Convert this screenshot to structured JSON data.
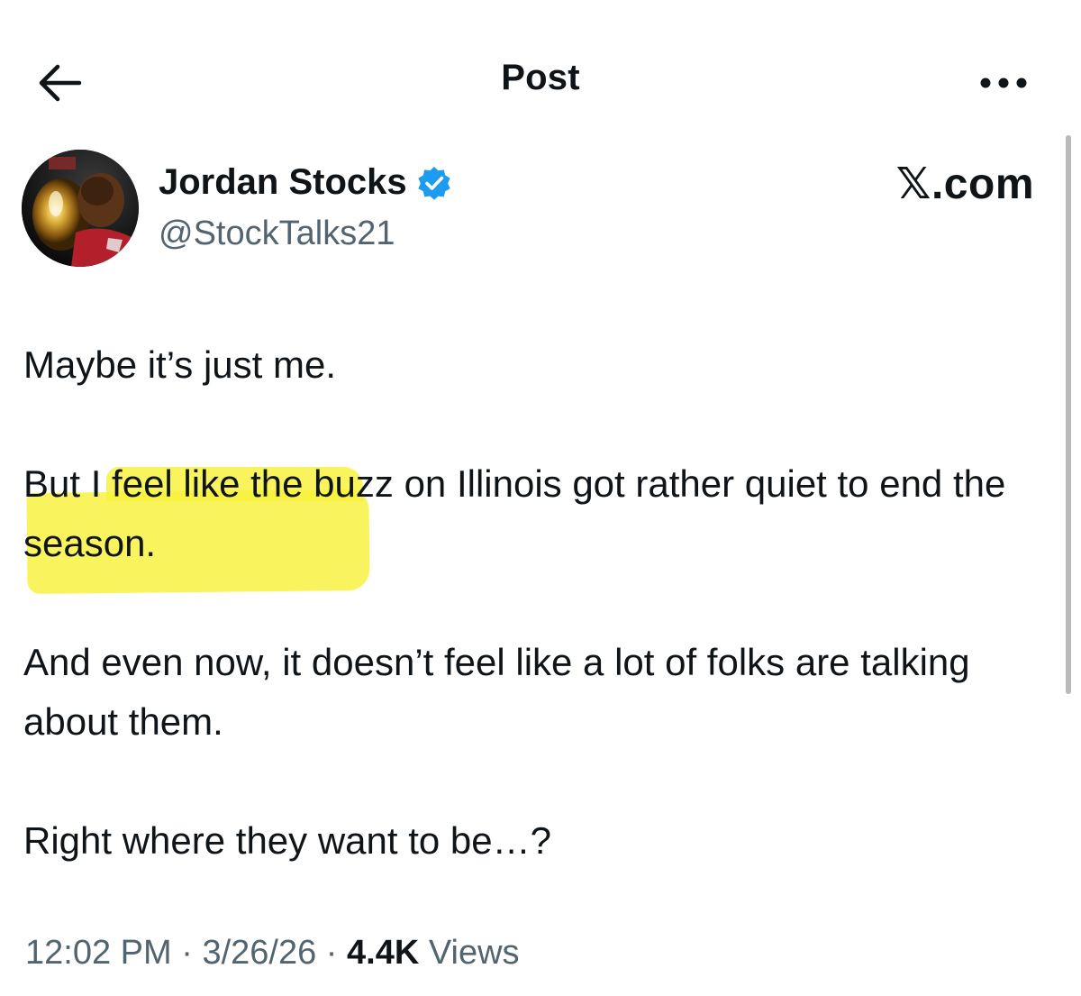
{
  "header": {
    "title": "Post",
    "back_icon": "arrow-left-icon",
    "more_icon": "ellipsis-icon"
  },
  "author": {
    "display_name": "Jordan Stocks",
    "handle": "@StockTalks21",
    "verified": true,
    "verified_color": "#1d9bf0"
  },
  "brand": "𝕏.com",
  "post": {
    "paragraphs": [
      "Maybe it’s just me.",
      "But I feel like the buzz on Illinois got rather quiet to end the season.",
      "And even now, it doesn’t feel like a lot of folks are talking about them.",
      "Right where they want to be…?"
    ],
    "highlight_color": "#f8f23a"
  },
  "meta": {
    "time": "12:02 PM",
    "separator": " · ",
    "date": "3/26/26",
    "views_count": "4.4K",
    "views_label": "Views"
  },
  "colors": {
    "text": "#0f1419",
    "secondary": "#536471"
  }
}
